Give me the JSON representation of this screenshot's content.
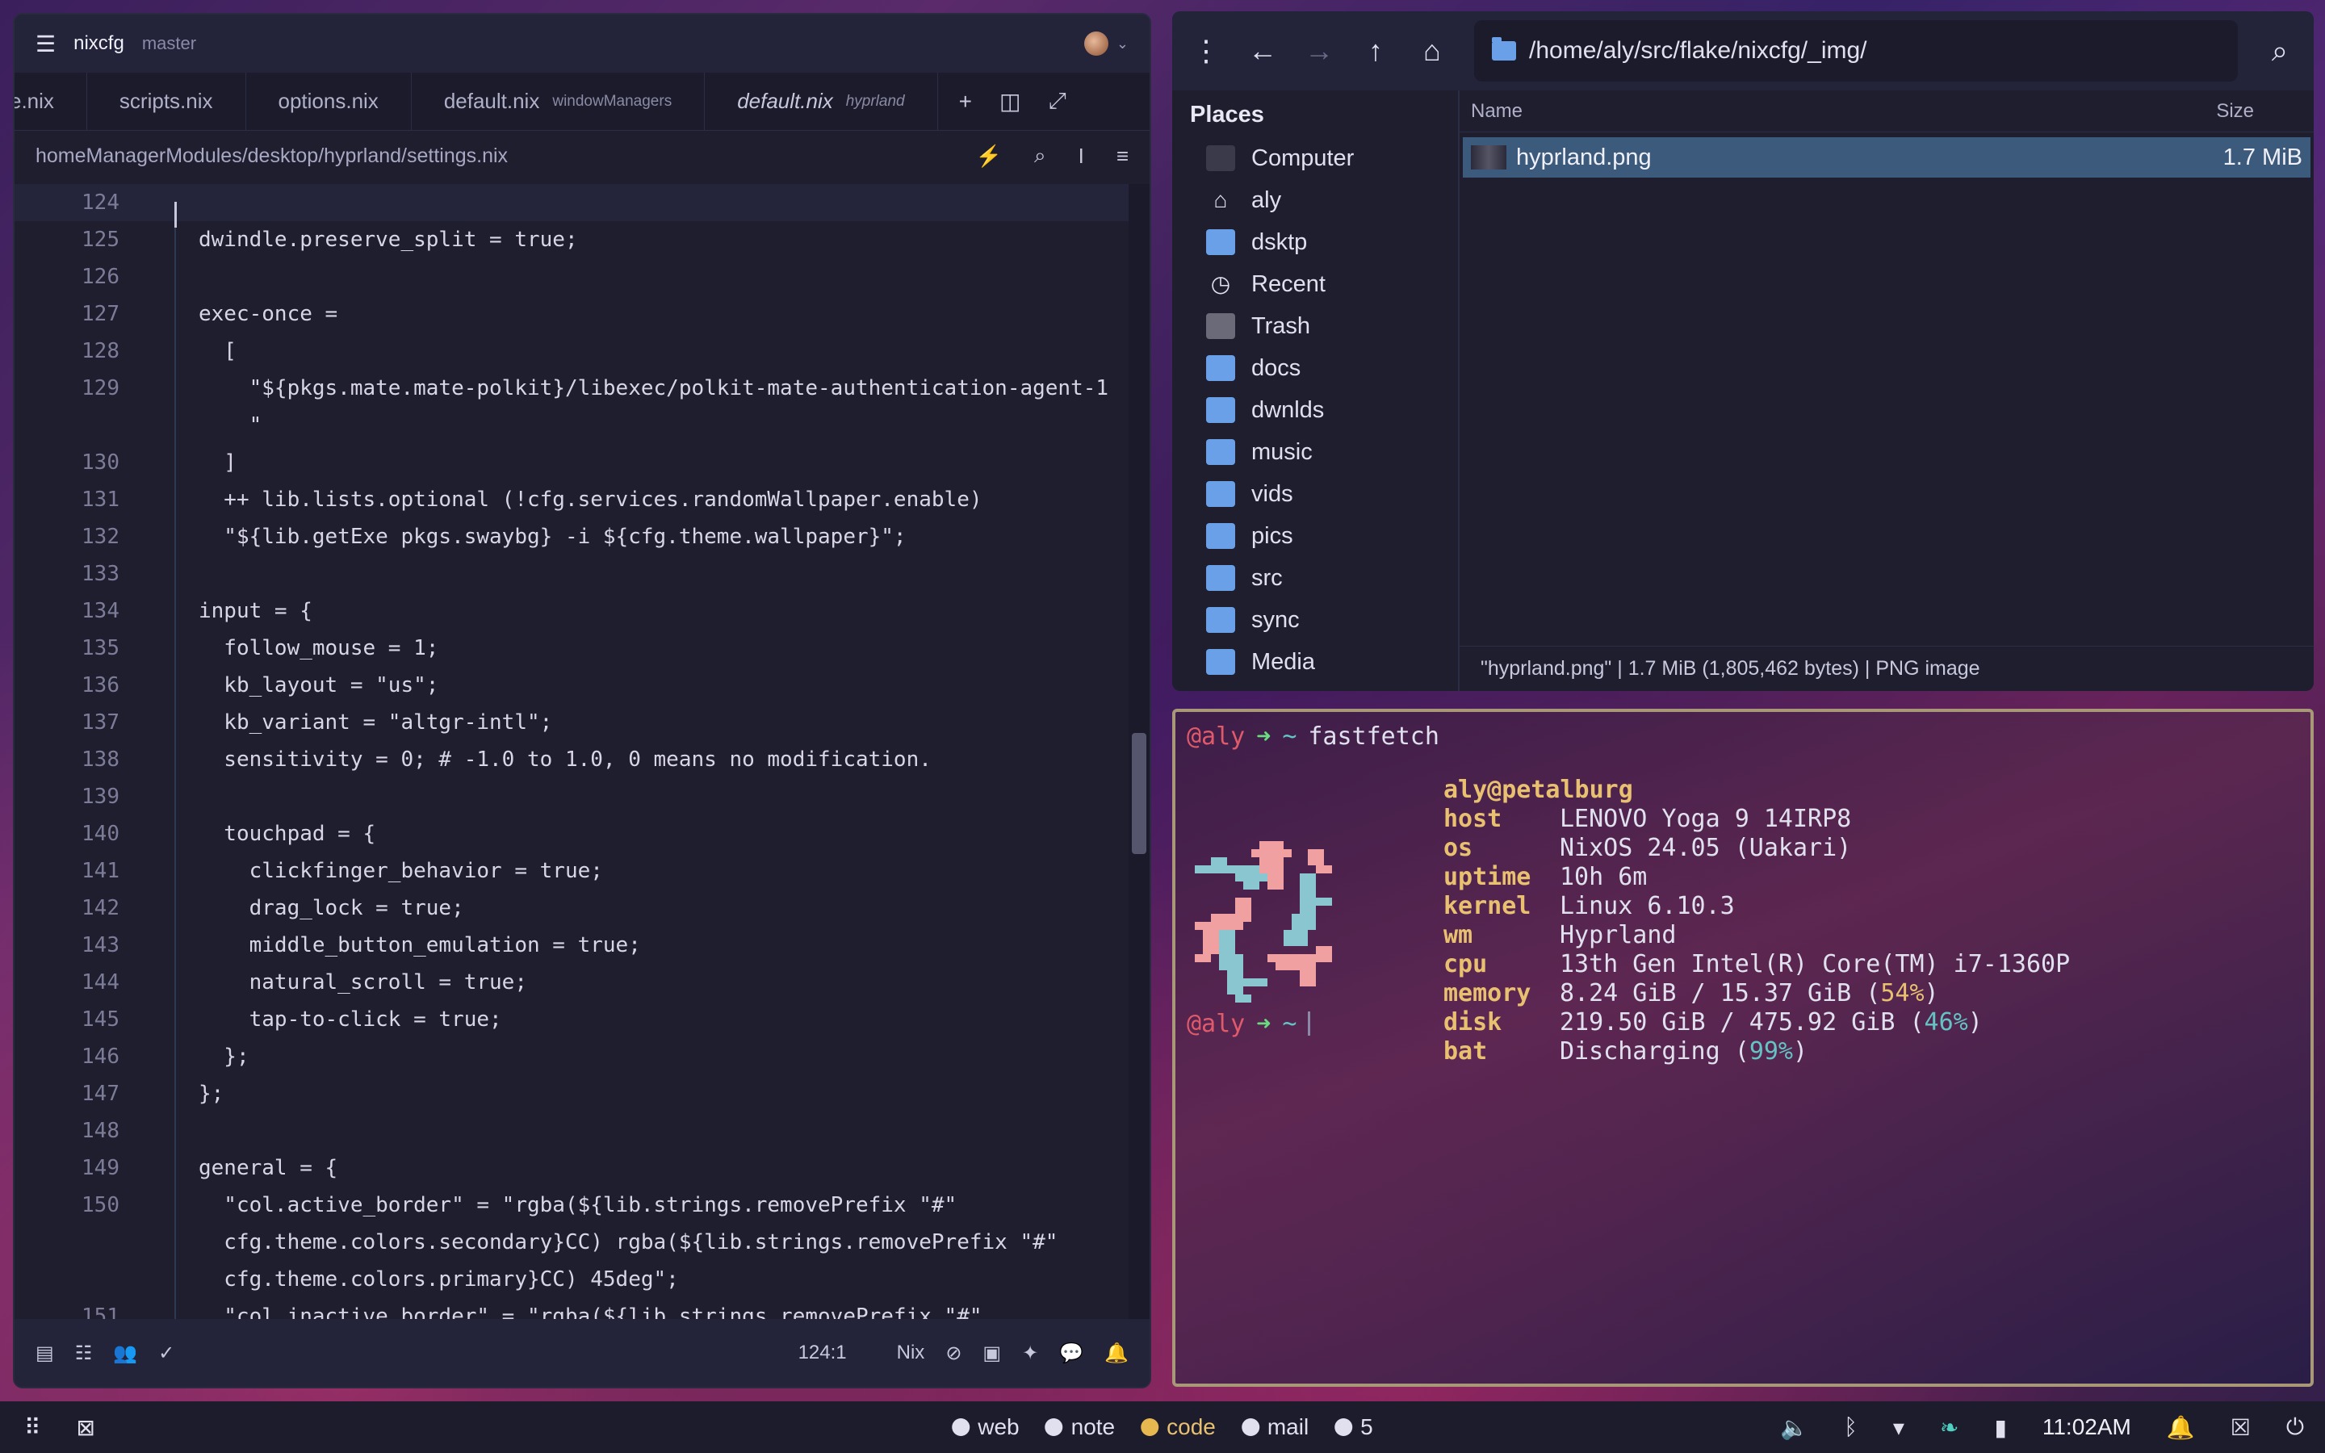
{
  "editor": {
    "project": "nixcfg",
    "branch": "master",
    "tabs": [
      {
        "label": "e.nix",
        "sub": ""
      },
      {
        "label": "scripts.nix",
        "sub": ""
      },
      {
        "label": "options.nix",
        "sub": ""
      },
      {
        "label": "default.nix",
        "sub": "windowManagers"
      },
      {
        "label": "default.nix",
        "sub": "hyprland"
      }
    ],
    "path": "homeManagerModules/desktop/hyprland/settings.nix",
    "status": {
      "position": "124:1",
      "language": "Nix"
    }
  },
  "code_lines": [
    {
      "n": "124",
      "t": ""
    },
    {
      "n": "125",
      "t": "dwindle.preserve_split = true;"
    },
    {
      "n": "126",
      "t": ""
    },
    {
      "n": "127",
      "t": "exec-once ="
    },
    {
      "n": "128",
      "t": "  ["
    },
    {
      "n": "129",
      "t": "    \"${pkgs.mate.mate-polkit}/libexec/polkit-mate-authentication-agent-1"
    },
    {
      "n": "",
      "t": "    \""
    },
    {
      "n": "130",
      "t": "  ]"
    },
    {
      "n": "131",
      "t": "  ++ lib.lists.optional (!cfg.services.randomWallpaper.enable)"
    },
    {
      "n": "132",
      "t": "  \"${lib.getExe pkgs.swaybg} -i ${cfg.theme.wallpaper}\";"
    },
    {
      "n": "133",
      "t": ""
    },
    {
      "n": "134",
      "t": "input = {"
    },
    {
      "n": "135",
      "t": "  follow_mouse = 1;"
    },
    {
      "n": "136",
      "t": "  kb_layout = \"us\";"
    },
    {
      "n": "137",
      "t": "  kb_variant = \"altgr-intl\";"
    },
    {
      "n": "138",
      "t": "  sensitivity = 0; # -1.0 to 1.0, 0 means no modification."
    },
    {
      "n": "139",
      "t": ""
    },
    {
      "n": "140",
      "t": "  touchpad = {"
    },
    {
      "n": "141",
      "t": "    clickfinger_behavior = true;"
    },
    {
      "n": "142",
      "t": "    drag_lock = true;"
    },
    {
      "n": "143",
      "t": "    middle_button_emulation = true;"
    },
    {
      "n": "144",
      "t": "    natural_scroll = true;"
    },
    {
      "n": "145",
      "t": "    tap-to-click = true;"
    },
    {
      "n": "146",
      "t": "  };"
    },
    {
      "n": "147",
      "t": "};"
    },
    {
      "n": "148",
      "t": ""
    },
    {
      "n": "149",
      "t": "general = {"
    },
    {
      "n": "150",
      "t": "  \"col.active_border\" = \"rgba(${lib.strings.removePrefix \"#\""
    },
    {
      "n": "",
      "t": "  cfg.theme.colors.secondary}CC) rgba(${lib.strings.removePrefix \"#\""
    },
    {
      "n": "",
      "t": "  cfg.theme.colors.primary}CC) 45deg\";"
    },
    {
      "n": "151",
      "t": "  \"col.inactive_border\" = \"rgba(${lib.strings.removePrefix \"#\""
    }
  ],
  "filemanager": {
    "path": "/home/aly/src/flake/nixcfg/_img/",
    "places_title": "Places",
    "places": [
      {
        "label": "Computer",
        "icon": "computer-icon"
      },
      {
        "label": "aly",
        "icon": "home-icon"
      },
      {
        "label": "dsktp",
        "icon": "folder-icon"
      },
      {
        "label": "Recent",
        "icon": "clock-icon"
      },
      {
        "label": "Trash",
        "icon": "trash-icon"
      },
      {
        "label": "docs",
        "icon": "folder-icon"
      },
      {
        "label": "dwnlds",
        "icon": "folder-icon"
      },
      {
        "label": "music",
        "icon": "folder-icon"
      },
      {
        "label": "vids",
        "icon": "folder-icon"
      },
      {
        "label": "pics",
        "icon": "folder-icon"
      },
      {
        "label": "src",
        "icon": "folder-icon"
      },
      {
        "label": "sync",
        "icon": "folder-icon"
      },
      {
        "label": "Media",
        "icon": "folder-icon"
      }
    ],
    "columns": {
      "name": "Name",
      "size": "Size"
    },
    "files": [
      {
        "name": "hyprland.png",
        "size": "1.7 MiB"
      }
    ],
    "status": "\"hyprland.png\"  |  1.7 MiB (1,805,462 bytes)  |  PNG image"
  },
  "terminal": {
    "user": "@aly",
    "arrow": "➜",
    "dir": "~",
    "command": "fastfetch",
    "userhost": "aly@petalburg",
    "info": [
      {
        "key": "host",
        "val": "LENOVO Yoga 9 14IRP8"
      },
      {
        "key": "os",
        "val": "NixOS 24.05 (Uakari)"
      },
      {
        "key": "uptime",
        "val": "10h 6m"
      },
      {
        "key": "kernel",
        "val": "Linux 6.10.3"
      },
      {
        "key": "wm",
        "val": "Hyprland"
      },
      {
        "key": "cpu",
        "val": "13th Gen Intel(R) Core(TM) i7-1360P"
      }
    ],
    "memory": {
      "key": "memory",
      "val": "8.24 GiB / 15.37 GiB (",
      "pct": "54%",
      "end": ")"
    },
    "disk": {
      "key": "disk",
      "val": "219.50 GiB / 475.92 GiB (",
      "pct": "46%",
      "end": ")"
    },
    "bat": {
      "key": "bat",
      "val": "Discharging (",
      "pct": "99%",
      "end": ")"
    }
  },
  "taskbar": {
    "workspaces": [
      {
        "label": "web",
        "active": false
      },
      {
        "label": "note",
        "active": false
      },
      {
        "label": "code",
        "active": true
      },
      {
        "label": "mail",
        "active": false
      },
      {
        "label": "5",
        "active": false
      }
    ],
    "clock": "11:02AM"
  },
  "colors": {
    "accent": "#e8b850",
    "selection": "#3c5a7c",
    "prompt_user": "#e05a6a",
    "prompt_arrow": "#6adc80"
  }
}
